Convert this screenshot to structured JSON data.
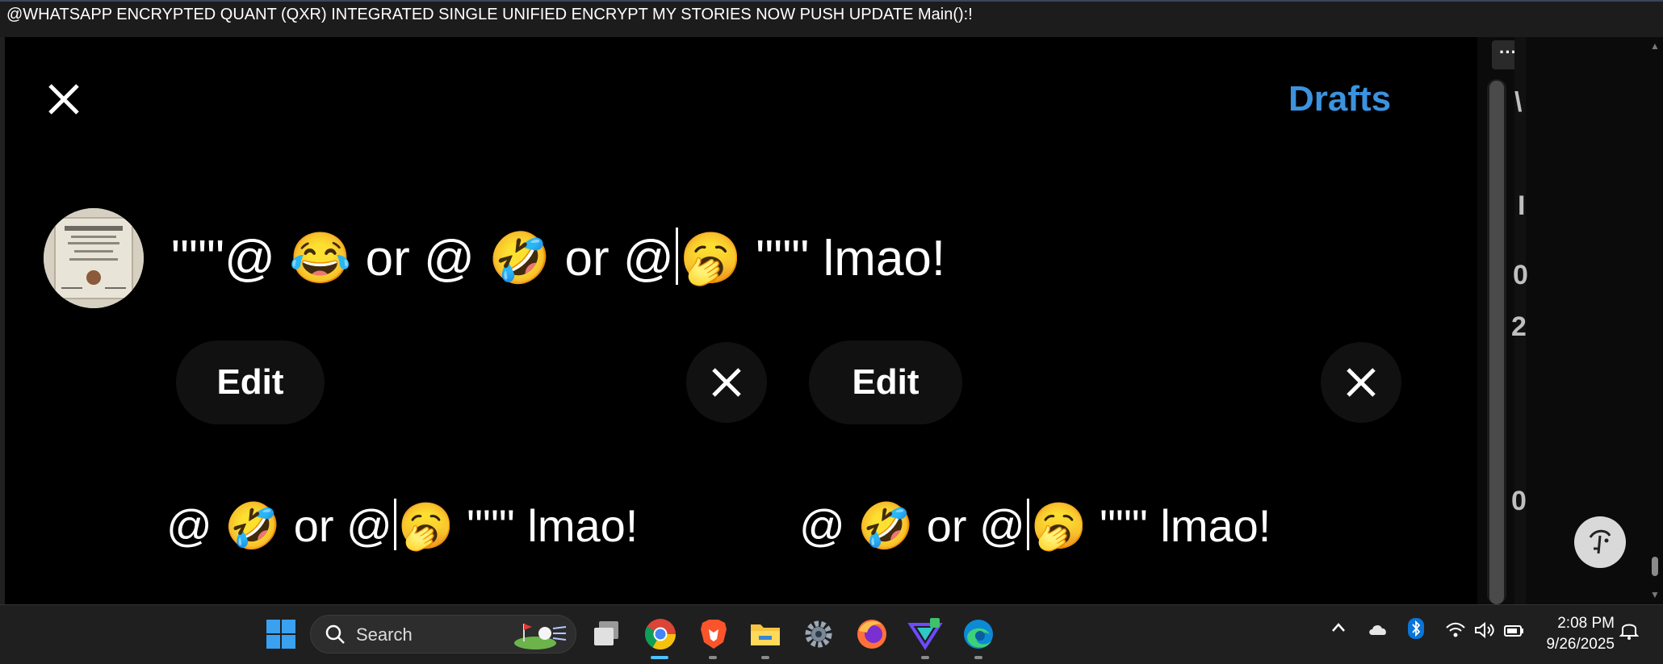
{
  "window": {
    "title": "@WHATSAPP ENCRYPTED QUANT (QXR) INTEGRATED SINGLE UNIFIED ENCRYPT MY STORIES NOW PUSH UPDATE Main():!"
  },
  "composer": {
    "drafts_label": "Drafts",
    "main_text_before": "\"\"\"@ 😂  or @ 🤣  or @",
    "main_text_after": "🥱 \"\"\" lmao!",
    "more_label": "···"
  },
  "edit_panels": [
    {
      "edit_label": "Edit",
      "text_before": "@ 🤣  or @",
      "text_after": "🥱 \"\"\" lmao!"
    },
    {
      "edit_label": "Edit",
      "text_before": "@ 🤣  or @",
      "text_after": "🥱 \"\"\" lmao!"
    }
  ],
  "side_glyphs": [
    "\\",
    "I",
    "0",
    "2",
    "0"
  ],
  "taskbar": {
    "search_label": "Search",
    "apps": [
      "windows-start",
      "task-view",
      "chrome",
      "brave",
      "file-explorer",
      "settings",
      "firefox",
      "vpn-app",
      "edge"
    ],
    "time": "2:08 PM",
    "date": "9/26/2025"
  },
  "colors": {
    "accent": "#3b93e0",
    "background": "#000000",
    "taskbar": "#1f1f1f"
  }
}
